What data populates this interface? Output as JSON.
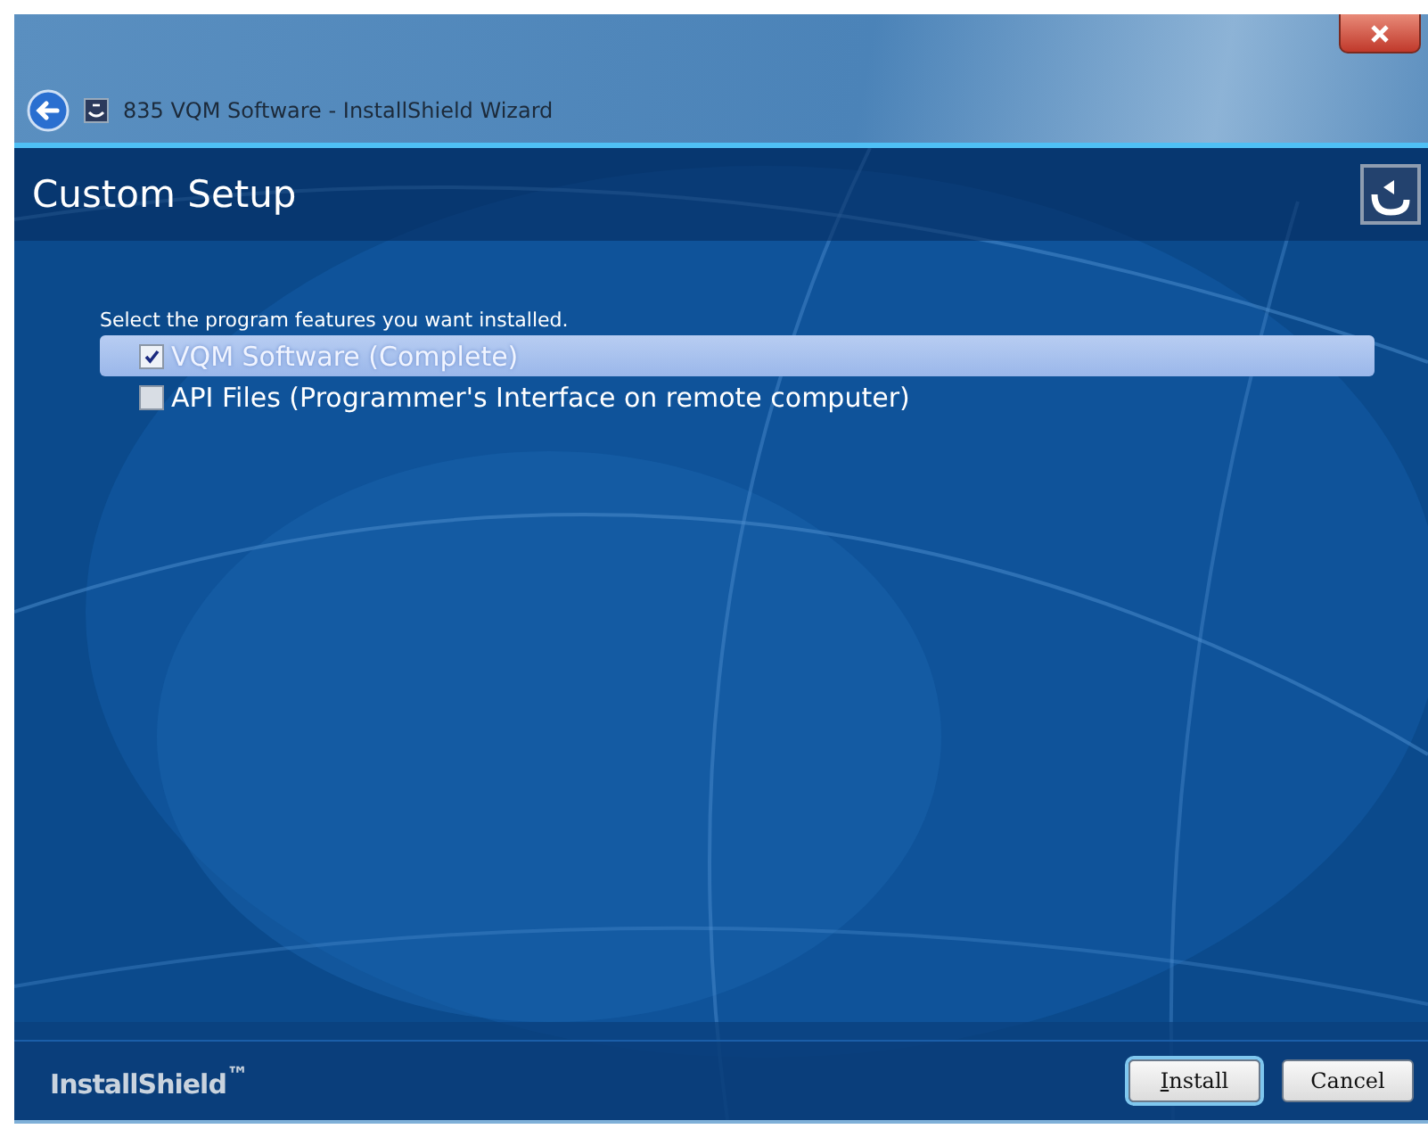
{
  "window": {
    "title": "835 VQM Software - InstallShield Wizard"
  },
  "header": {
    "title": "Custom Setup"
  },
  "instruction": "Select the program features you want installed.",
  "features": [
    {
      "label": "VQM Software (Complete)",
      "checked": true,
      "selected": true
    },
    {
      "label": "API Files (Programmer's Interface on remote computer)",
      "checked": false,
      "selected": false
    }
  ],
  "footer": {
    "brand": "InstallShield$^{™}$"
  },
  "buttons": [
    {
      "label": "Install",
      "first_letter_underlined": true
    },
    {
      "label": "Cancel",
      "first_letter_underlined": false
    }
  ]
}
